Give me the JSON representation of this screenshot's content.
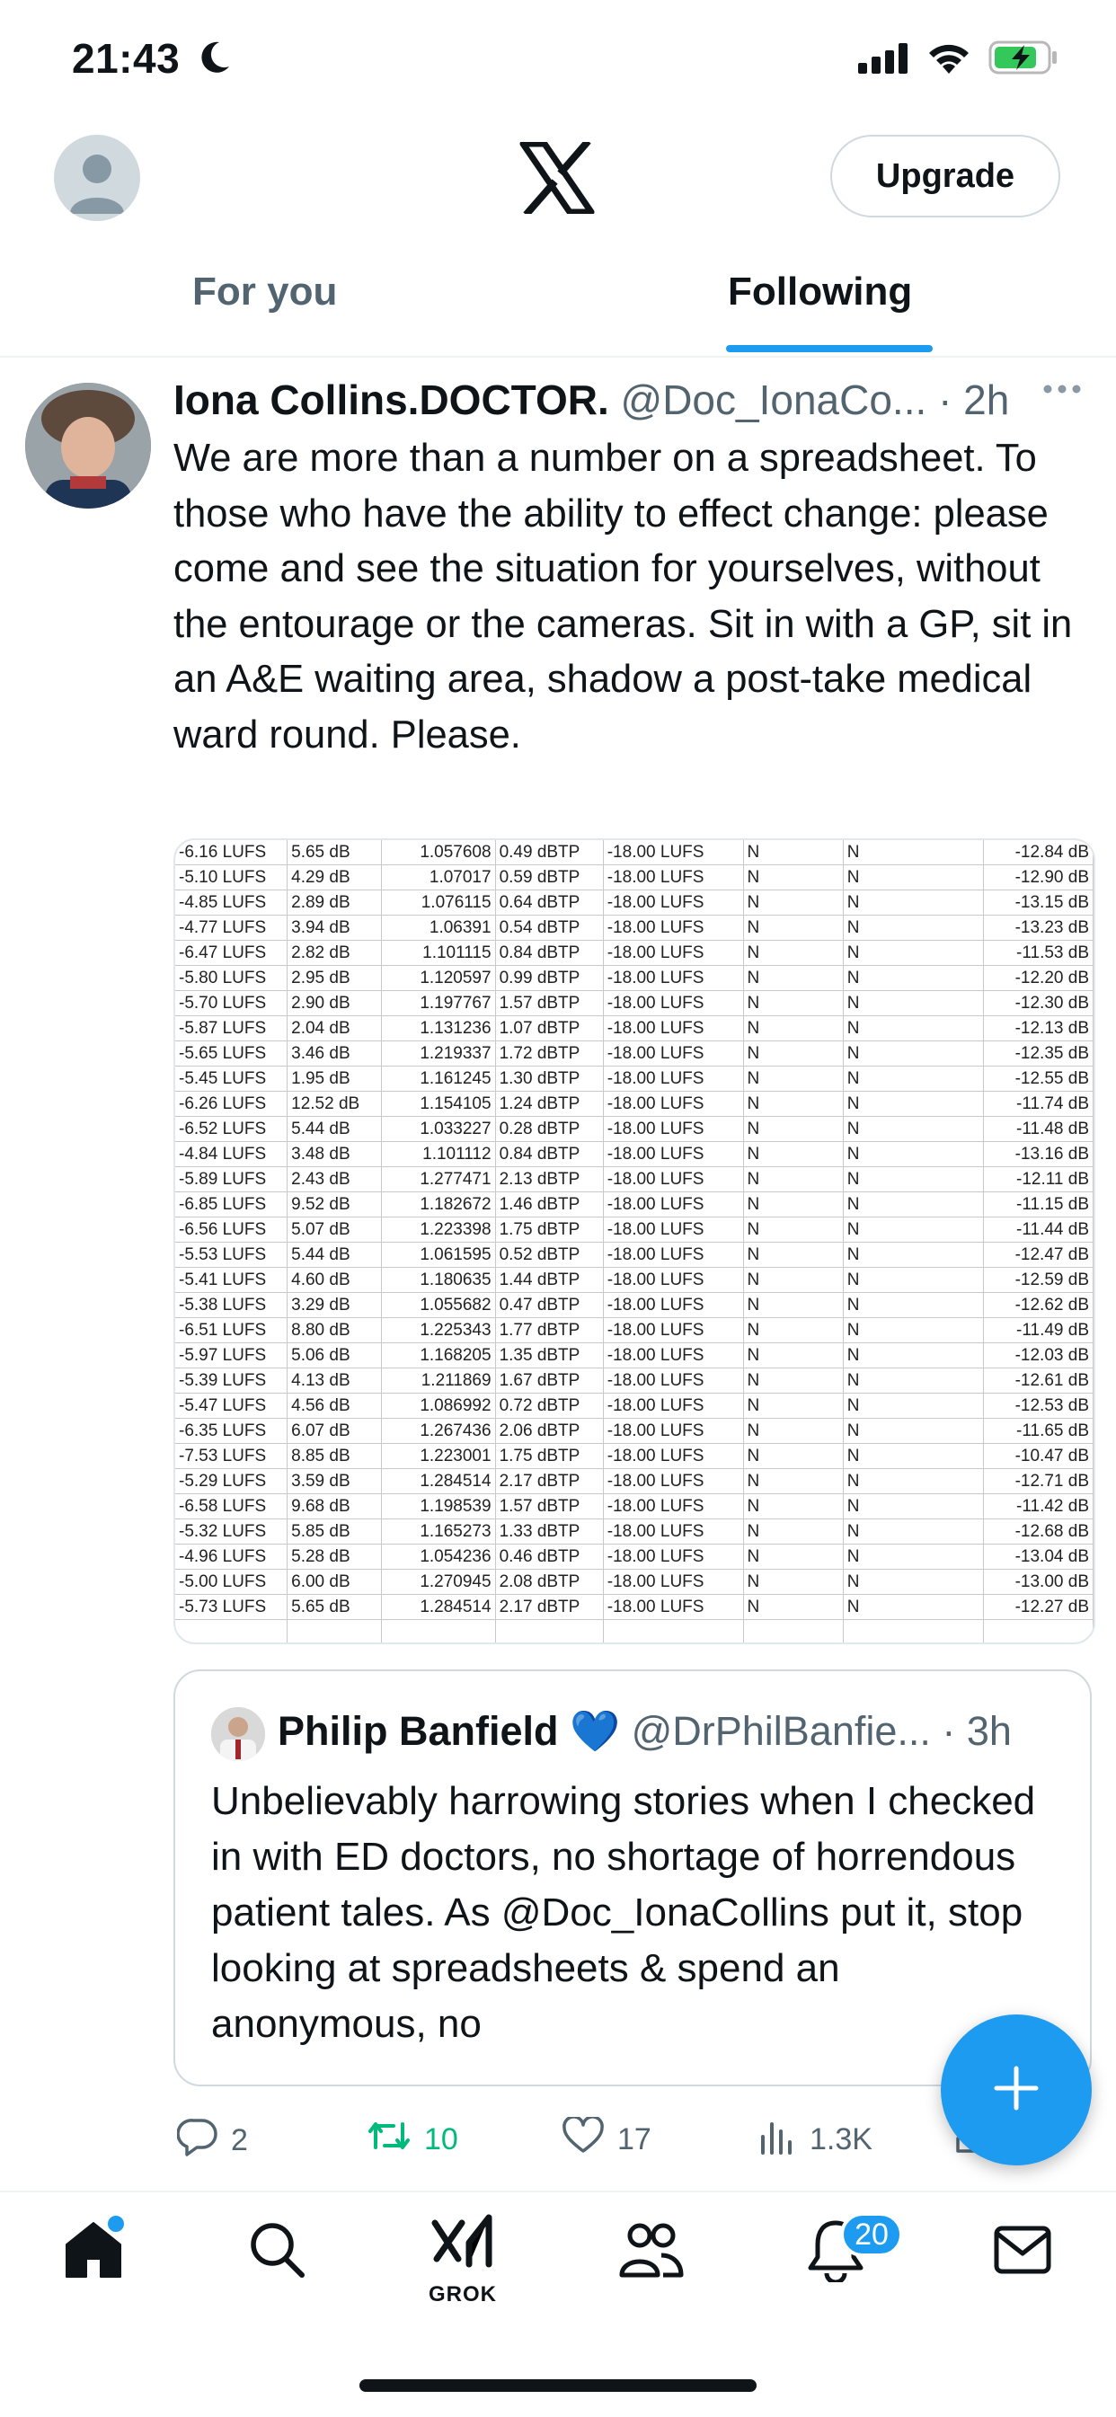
{
  "status": {
    "time": "21:43"
  },
  "header": {
    "upgrade_label": "Upgrade"
  },
  "tabs": [
    {
      "label": "For you"
    },
    {
      "label": "Following"
    }
  ],
  "post": {
    "author": "Iona Collins.DOCTOR.",
    "handle": "@Doc_IonaCo...",
    "time": "· 2h",
    "text": "We are more than a number on a spreadsheet. To those who have the ability to effect change: please come and see the situation for yourselves, without the entourage or the cameras. Sit in with a GP, sit in an A&E waiting area, shadow a post-take medical ward round. Please.",
    "spreadsheet_rows": [
      [
        "-6.16 LUFS",
        "5.65 dB",
        "1.057608",
        "0.49 dBTP",
        "-18.00 LUFS",
        "N",
        "N",
        "-12.84 dB"
      ],
      [
        "-5.10 LUFS",
        "4.29 dB",
        "1.07017",
        "0.59 dBTP",
        "-18.00 LUFS",
        "N",
        "N",
        "-12.90 dB"
      ],
      [
        "-4.85 LUFS",
        "2.89 dB",
        "1.076115",
        "0.64 dBTP",
        "-18.00 LUFS",
        "N",
        "N",
        "-13.15 dB"
      ],
      [
        "-4.77 LUFS",
        "3.94 dB",
        "1.06391",
        "0.54 dBTP",
        "-18.00 LUFS",
        "N",
        "N",
        "-13.23 dB"
      ],
      [
        "-6.47 LUFS",
        "2.82 dB",
        "1.101115",
        "0.84 dBTP",
        "-18.00 LUFS",
        "N",
        "N",
        "-11.53 dB"
      ],
      [
        "-5.80 LUFS",
        "2.95 dB",
        "1.120597",
        "0.99 dBTP",
        "-18.00 LUFS",
        "N",
        "N",
        "-12.20 dB"
      ],
      [
        "-5.70 LUFS",
        "2.90 dB",
        "1.197767",
        "1.57 dBTP",
        "-18.00 LUFS",
        "N",
        "N",
        "-12.30 dB"
      ],
      [
        "-5.87 LUFS",
        "2.04 dB",
        "1.131236",
        "1.07 dBTP",
        "-18.00 LUFS",
        "N",
        "N",
        "-12.13 dB"
      ],
      [
        "-5.65 LUFS",
        "3.46 dB",
        "1.219337",
        "1.72 dBTP",
        "-18.00 LUFS",
        "N",
        "N",
        "-12.35 dB"
      ],
      [
        "-5.45 LUFS",
        "1.95 dB",
        "1.161245",
        "1.30 dBTP",
        "-18.00 LUFS",
        "N",
        "N",
        "-12.55 dB"
      ],
      [
        "-6.26 LUFS",
        "12.52 dB",
        "1.154105",
        "1.24 dBTP",
        "-18.00 LUFS",
        "N",
        "N",
        "-11.74 dB"
      ],
      [
        "-6.52 LUFS",
        "5.44 dB",
        "1.033227",
        "0.28 dBTP",
        "-18.00 LUFS",
        "N",
        "N",
        "-11.48 dB"
      ],
      [
        "-4.84 LUFS",
        "3.48 dB",
        "1.101112",
        "0.84 dBTP",
        "-18.00 LUFS",
        "N",
        "N",
        "-13.16 dB"
      ],
      [
        "-5.89 LUFS",
        "2.43 dB",
        "1.277471",
        "2.13 dBTP",
        "-18.00 LUFS",
        "N",
        "N",
        "-12.11 dB"
      ],
      [
        "-6.85 LUFS",
        "9.52 dB",
        "1.182672",
        "1.46 dBTP",
        "-18.00 LUFS",
        "N",
        "N",
        "-11.15 dB"
      ],
      [
        "-6.56 LUFS",
        "5.07 dB",
        "1.223398",
        "1.75 dBTP",
        "-18.00 LUFS",
        "N",
        "N",
        "-11.44 dB"
      ],
      [
        "-5.53 LUFS",
        "5.44 dB",
        "1.061595",
        "0.52 dBTP",
        "-18.00 LUFS",
        "N",
        "N",
        "-12.47 dB"
      ],
      [
        "-5.41 LUFS",
        "4.60 dB",
        "1.180635",
        "1.44 dBTP",
        "-18.00 LUFS",
        "N",
        "N",
        "-12.59 dB"
      ],
      [
        "-5.38 LUFS",
        "3.29 dB",
        "1.055682",
        "0.47 dBTP",
        "-18.00 LUFS",
        "N",
        "N",
        "-12.62 dB"
      ],
      [
        "-6.51 LUFS",
        "8.80 dB",
        "1.225343",
        "1.77 dBTP",
        "-18.00 LUFS",
        "N",
        "N",
        "-11.49 dB"
      ],
      [
        "-5.97 LUFS",
        "5.06 dB",
        "1.168205",
        "1.35 dBTP",
        "-18.00 LUFS",
        "N",
        "N",
        "-12.03 dB"
      ],
      [
        "-5.39 LUFS",
        "4.13 dB",
        "1.211869",
        "1.67 dBTP",
        "-18.00 LUFS",
        "N",
        "N",
        "-12.61 dB"
      ],
      [
        "-5.47 LUFS",
        "4.56 dB",
        "1.086992",
        "0.72 dBTP",
        "-18.00 LUFS",
        "N",
        "N",
        "-12.53 dB"
      ],
      [
        "-6.35 LUFS",
        "6.07 dB",
        "1.267436",
        "2.06 dBTP",
        "-18.00 LUFS",
        "N",
        "N",
        "-11.65 dB"
      ],
      [
        "-7.53 LUFS",
        "8.85 dB",
        "1.223001",
        "1.75 dBTP",
        "-18.00 LUFS",
        "N",
        "N",
        "-10.47 dB"
      ],
      [
        "-5.29 LUFS",
        "3.59 dB",
        "1.284514",
        "2.17 dBTP",
        "-18.00 LUFS",
        "N",
        "N",
        "-12.71 dB"
      ],
      [
        "-6.58 LUFS",
        "9.68 dB",
        "1.198539",
        "1.57 dBTP",
        "-18.00 LUFS",
        "N",
        "N",
        "-11.42 dB"
      ],
      [
        "-5.32 LUFS",
        "5.85 dB",
        "1.165273",
        "1.33 dBTP",
        "-18.00 LUFS",
        "N",
        "N",
        "-12.68 dB"
      ],
      [
        "-4.96 LUFS",
        "5.28 dB",
        "1.054236",
        "0.46 dBTP",
        "-18.00 LUFS",
        "N",
        "N",
        "-13.04 dB"
      ],
      [
        "-5.00 LUFS",
        "6.00 dB",
        "1.270945",
        "2.08 dBTP",
        "-18.00 LUFS",
        "N",
        "N",
        "-13.00 dB"
      ],
      [
        "-5.73 LUFS",
        "5.65 dB",
        "1.284514",
        "2.17 dBTP",
        "-18.00 LUFS",
        "N",
        "N",
        "-12.27 dB"
      ]
    ]
  },
  "quote": {
    "author": "Philip Banfield",
    "heart": "💙",
    "handle": "@DrPhilBanfie...",
    "time": "· 3h",
    "text": "Unbelievably harrowing stories when I checked in with ED doctors, no shortage of horrendous patient tales. As @Doc_IonaCollins put it, stop looking at spreadsheets & spend an anonymous, no"
  },
  "actions": {
    "replies": "2",
    "reposts": "10",
    "likes": "17",
    "views": "1.3K"
  },
  "nav": {
    "grok_label": "GROK",
    "notifications_badge": "20"
  },
  "colors": {
    "accent": "#1d9bf0",
    "repost_green": "#00ba7c",
    "muted": "#536471"
  }
}
